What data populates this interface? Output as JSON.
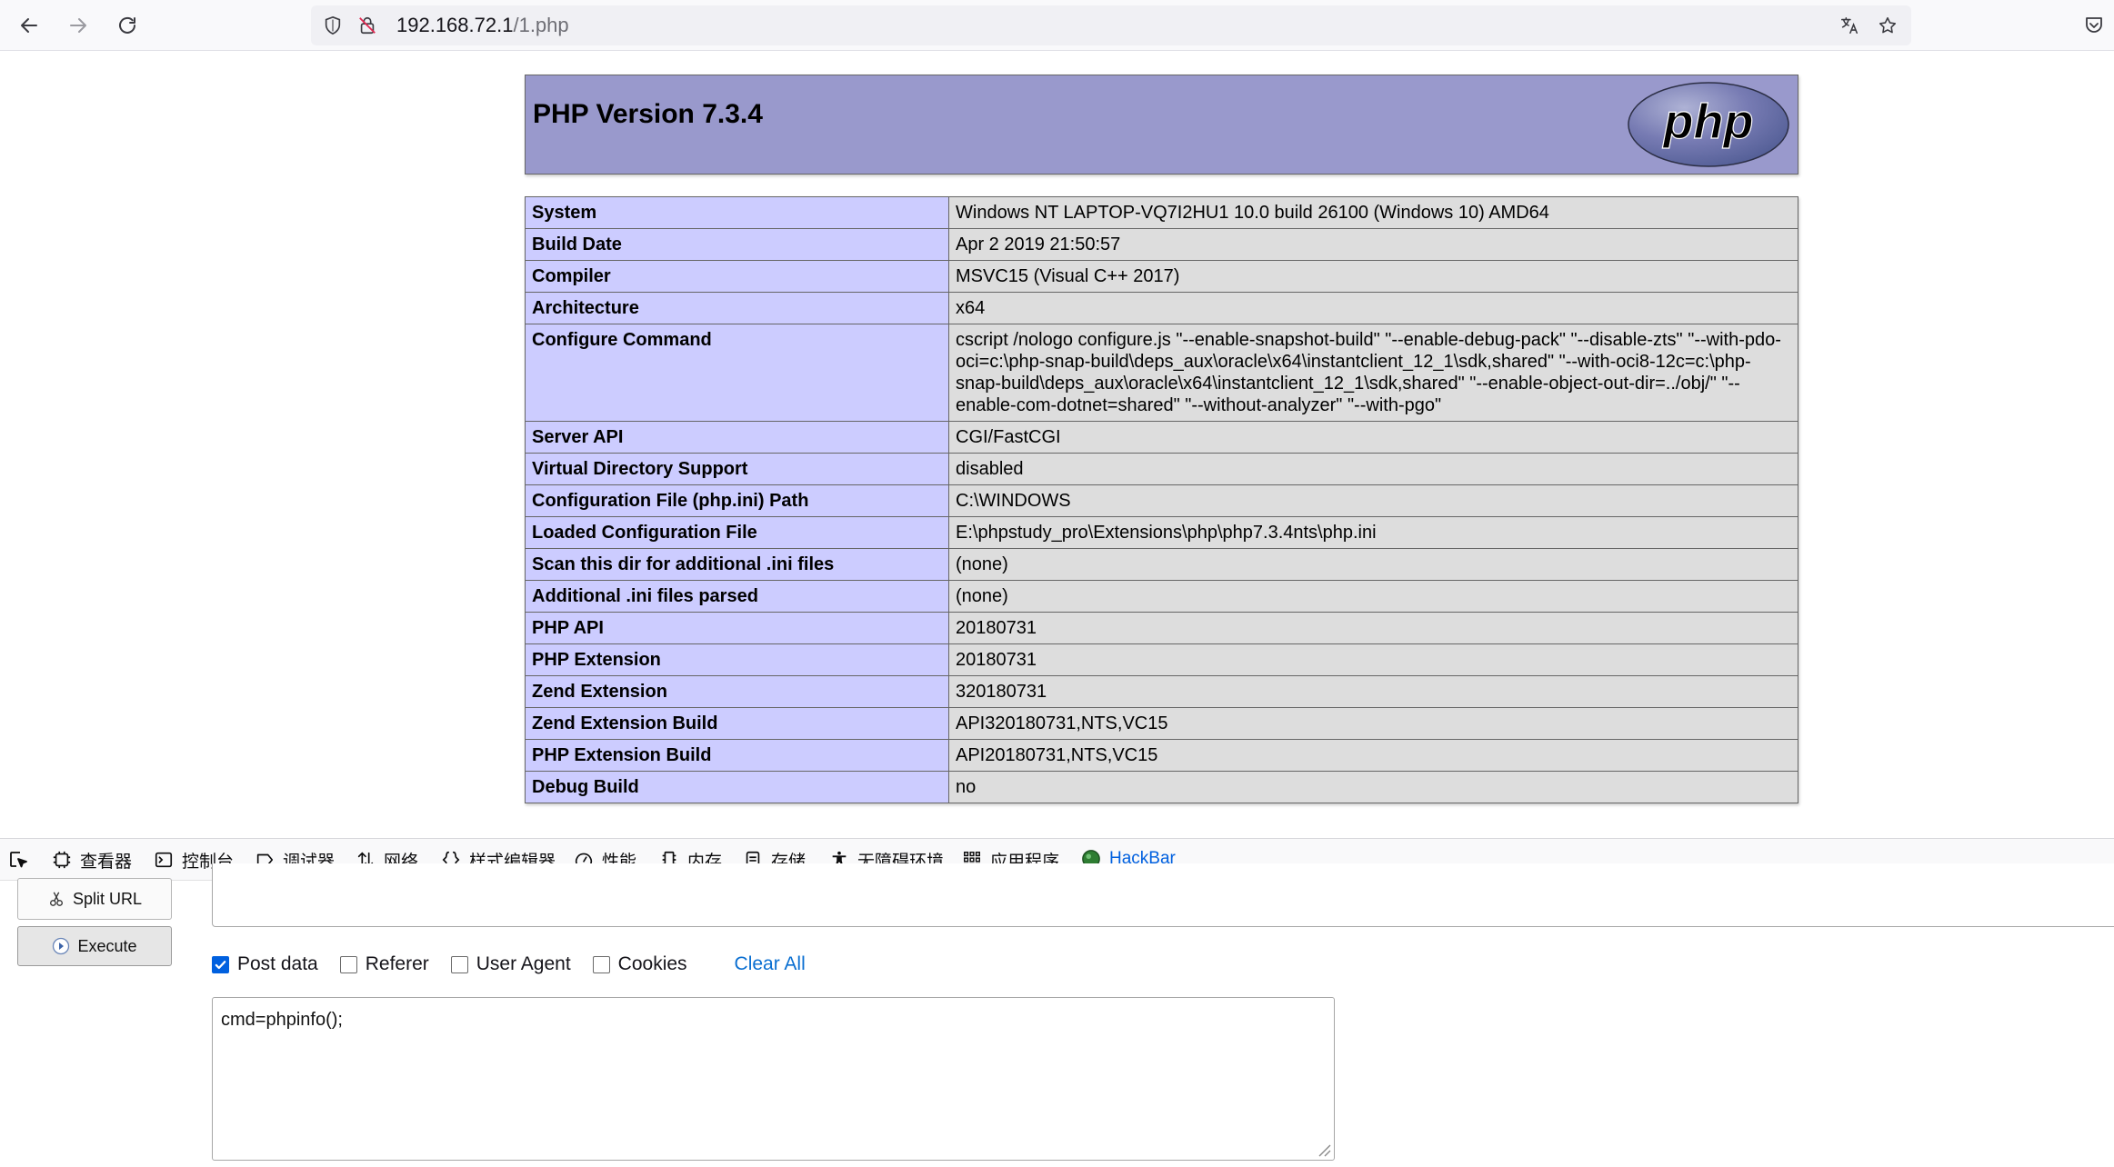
{
  "browser": {
    "url_host": "192.168.72.1",
    "url_path": "/1.php"
  },
  "php": {
    "title": "PHP Version 7.3.4",
    "logo_text": "php",
    "rows": [
      {
        "key": "System",
        "value": "Windows NT LAPTOP-VQ7I2HU1 10.0 build 26100 (Windows 10) AMD64"
      },
      {
        "key": "Build Date",
        "value": "Apr 2 2019 21:50:57"
      },
      {
        "key": "Compiler",
        "value": "MSVC15 (Visual C++ 2017)"
      },
      {
        "key": "Architecture",
        "value": "x64"
      },
      {
        "key": "Configure Command",
        "value": "cscript /nologo configure.js \"--enable-snapshot-build\" \"--enable-debug-pack\" \"--disable-zts\" \"--with-pdo-oci=c:\\php-snap-build\\deps_aux\\oracle\\x64\\instantclient_12_1\\sdk,shared\" \"--with-oci8-12c=c:\\php-snap-build\\deps_aux\\oracle\\x64\\instantclient_12_1\\sdk,shared\" \"--enable-object-out-dir=../obj/\" \"--enable-com-dotnet=shared\" \"--without-analyzer\" \"--with-pgo\""
      },
      {
        "key": "Server API",
        "value": "CGI/FastCGI"
      },
      {
        "key": "Virtual Directory Support",
        "value": "disabled"
      },
      {
        "key": "Configuration File (php.ini) Path",
        "value": "C:\\WINDOWS"
      },
      {
        "key": "Loaded Configuration File",
        "value": "E:\\phpstudy_pro\\Extensions\\php\\php7.3.4nts\\php.ini"
      },
      {
        "key": "Scan this dir for additional .ini files",
        "value": "(none)"
      },
      {
        "key": "Additional .ini files parsed",
        "value": "(none)"
      },
      {
        "key": "PHP API",
        "value": "20180731"
      },
      {
        "key": "PHP Extension",
        "value": "20180731"
      },
      {
        "key": "Zend Extension",
        "value": "320180731"
      },
      {
        "key": "Zend Extension Build",
        "value": "API320180731,NTS,VC15"
      },
      {
        "key": "PHP Extension Build",
        "value": "API20180731,NTS,VC15"
      },
      {
        "key": "Debug Build",
        "value": "no"
      }
    ]
  },
  "devtools": {
    "tabs": [
      {
        "label": "查看器",
        "icon": "inspector-icon"
      },
      {
        "label": "控制台",
        "icon": "console-icon"
      },
      {
        "label": "调试器",
        "icon": "debugger-icon"
      },
      {
        "label": "网络",
        "icon": "network-icon"
      },
      {
        "label": "样式编辑器",
        "icon": "style-editor-icon"
      },
      {
        "label": "性能",
        "icon": "performance-icon"
      },
      {
        "label": "内存",
        "icon": "memory-icon"
      },
      {
        "label": "存储",
        "icon": "storage-icon"
      },
      {
        "label": "无障碍环境",
        "icon": "accessibility-icon"
      },
      {
        "label": "应用程序",
        "icon": "application-icon"
      },
      {
        "label": "HackBar",
        "icon": "hackbar-icon"
      }
    ],
    "active_tab": "HackBar"
  },
  "hackbar": {
    "split_url_label": "Split URL",
    "execute_label": "Execute",
    "options": [
      {
        "label": "Post data",
        "checked": true
      },
      {
        "label": "Referer",
        "checked": false
      },
      {
        "label": "User Agent",
        "checked": false
      },
      {
        "label": "Cookies",
        "checked": false
      }
    ],
    "clear_all_label": "Clear All",
    "post_data_value": "cmd=phpinfo();"
  },
  "colors": {
    "php_header_bg": "#9999cc",
    "php_key_bg": "#ccccff",
    "php_value_bg": "#dddddd",
    "active_tab": "#0060df"
  }
}
